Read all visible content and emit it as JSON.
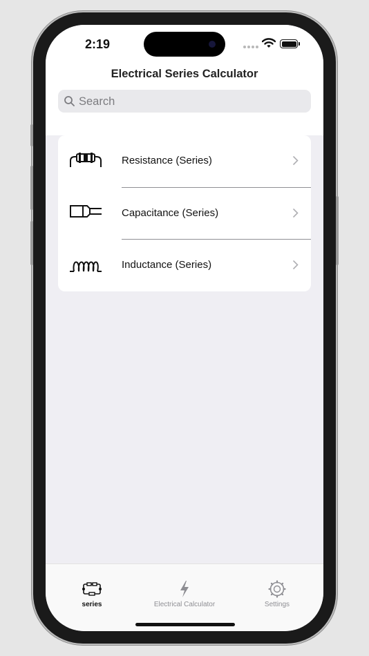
{
  "status_bar": {
    "time": "2:19",
    "icons": [
      "signal-dots-icon",
      "wifi-icon",
      "battery-icon"
    ]
  },
  "nav": {
    "title": "Electrical Series Calculator"
  },
  "search": {
    "placeholder": "Search",
    "value": ""
  },
  "list": {
    "items": [
      {
        "label": "Resistance (Series)",
        "icon": "resistor-icon"
      },
      {
        "label": "Capacitance (Series)",
        "icon": "capacitor-icon"
      },
      {
        "label": "Inductance (Series)",
        "icon": "inductor-icon"
      }
    ]
  },
  "tabs": [
    {
      "label": "series",
      "icon": "series-circuit-icon",
      "active": true
    },
    {
      "label": "Electrical Calculator",
      "icon": "lightning-bolt-icon",
      "active": false
    },
    {
      "label": "Settings",
      "icon": "gear-icon",
      "active": false
    }
  ],
  "colors": {
    "background": "#efeef3",
    "text": "#111111",
    "inactive": "#8e8e93"
  }
}
